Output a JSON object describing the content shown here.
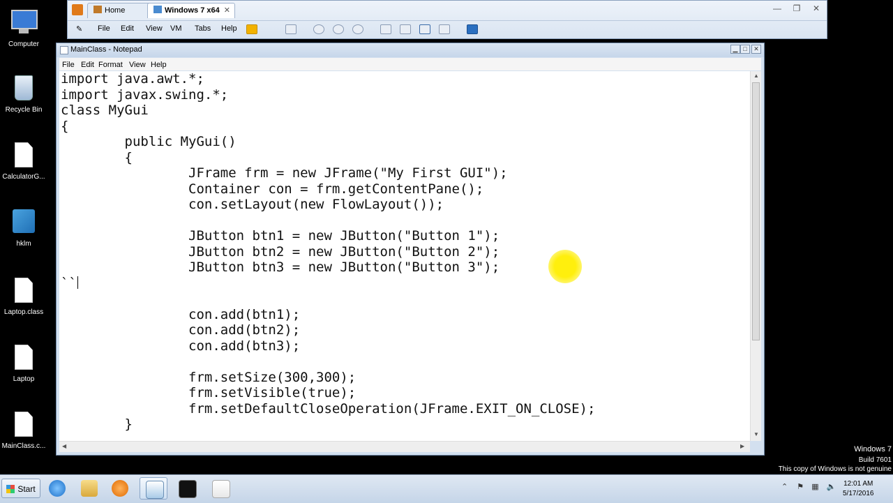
{
  "desktop": {
    "icons": [
      {
        "label": "Computer"
      },
      {
        "label": "Recycle Bin"
      },
      {
        "label": "CalculatorG..."
      },
      {
        "label": "hklm"
      },
      {
        "label": "Laptop.class"
      },
      {
        "label": "Laptop"
      },
      {
        "label": "MainClass.c..."
      }
    ]
  },
  "vmware": {
    "tabs": [
      {
        "label": "Home"
      },
      {
        "label": "Windows 7 x64"
      }
    ],
    "menu": [
      "File",
      "Edit",
      "View",
      "VM",
      "Tabs",
      "Help"
    ]
  },
  "notepad": {
    "title": "MainClass - Notepad",
    "menu": [
      "File",
      "Edit",
      "Format",
      "View",
      "Help"
    ],
    "code": "import java.awt.*;\nimport javax.swing.*;\nclass MyGui\n{\n        public MyGui()\n        {\n                JFrame frm = new JFrame(\"My First GUI\");\n                Container con = frm.getContentPane();\n                con.setLayout(new FlowLayout());\n\n                JButton btn1 = new JButton(\"Button 1\");\n                JButton btn2 = new JButton(\"Button 2\");\n                JButton btn3 = new JButton(\"Button 3\");\n``\n\n                con.add(btn1);\n                con.add(btn2);\n                con.add(btn3);\n\n                frm.setSize(300,300);\n                frm.setVisible(true);\n                frm.setDefaultCloseOperation(JFrame.EXIT_ON_CLOSE);\n        }"
  },
  "watermark": {
    "line1": "Windows 7",
    "line2": "Build 7601",
    "line3": "This copy of Windows is not genuine"
  },
  "taskbar": {
    "start_label": "Start",
    "time": "12:01 AM",
    "date": "5/17/2016"
  }
}
